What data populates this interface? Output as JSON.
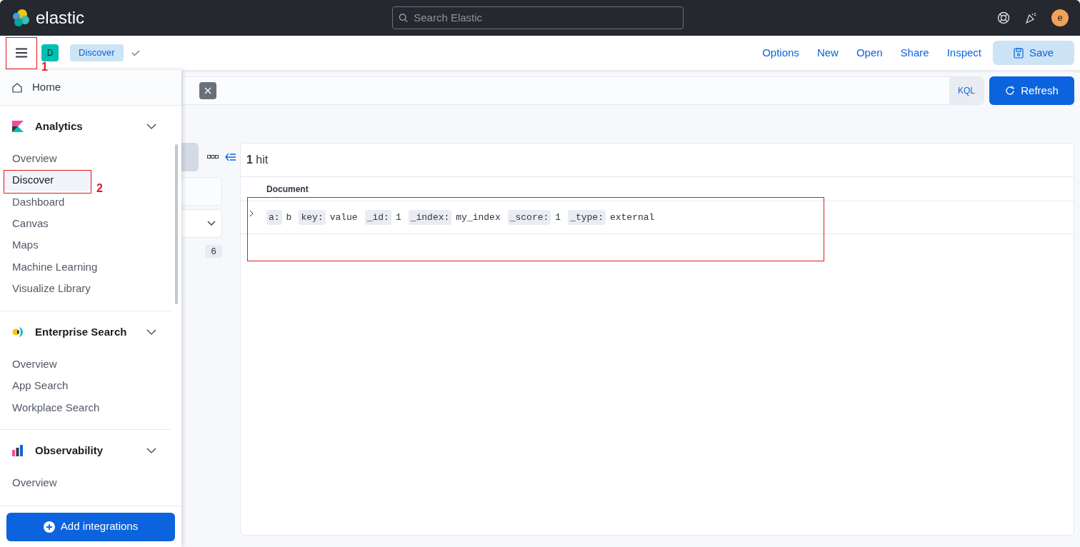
{
  "header": {
    "logo_text": "elastic",
    "search_placeholder": "Search Elastic",
    "avatar": "e"
  },
  "app_bar": {
    "space": "D",
    "breadcrumb": "Discover",
    "links": [
      "Options",
      "New",
      "Open",
      "Share",
      "Inspect"
    ],
    "save": "Save"
  },
  "query_bar": {
    "language": "KQL",
    "refresh": "Refresh"
  },
  "field_sidebar": {
    "count": "6"
  },
  "results": {
    "hit_count": "1",
    "hit_label": "hit",
    "column": "Document",
    "rows": [
      {
        "expanded": false,
        "fields": [
          {
            "key": "a:",
            "value": "b"
          },
          {
            "key": "key:",
            "value": "value"
          },
          {
            "key": "_id:",
            "value": "1"
          },
          {
            "key": "_index:",
            "value": "my_index"
          },
          {
            "key": "_score:",
            "value": "1"
          },
          {
            "key": "_type:",
            "value": "external"
          }
        ]
      }
    ]
  },
  "nav": {
    "home": "Home",
    "groups": [
      {
        "kind": "analytics",
        "title": "Analytics",
        "expanded": true,
        "items": [
          {
            "label": "Overview",
            "selected": false
          },
          {
            "label": "Discover",
            "selected": true
          },
          {
            "label": "Dashboard",
            "selected": false
          },
          {
            "label": "Canvas",
            "selected": false
          },
          {
            "label": "Maps",
            "selected": false
          },
          {
            "label": "Machine Learning",
            "selected": false
          },
          {
            "label": "Visualize Library",
            "selected": false
          }
        ]
      },
      {
        "kind": "enterprise",
        "title": "Enterprise Search",
        "expanded": true,
        "items": [
          {
            "label": "Overview",
            "selected": false
          },
          {
            "label": "App Search",
            "selected": false
          },
          {
            "label": "Workplace Search",
            "selected": false
          }
        ]
      },
      {
        "kind": "observability",
        "title": "Observability",
        "expanded": true,
        "items": [
          {
            "label": "Overview",
            "selected": false
          }
        ]
      }
    ],
    "add_button": "Add integrations"
  },
  "annotations": [
    {
      "kind": "numbered",
      "label": "1"
    },
    {
      "kind": "numbered",
      "label": "2"
    },
    {
      "kind": "box"
    }
  ]
}
